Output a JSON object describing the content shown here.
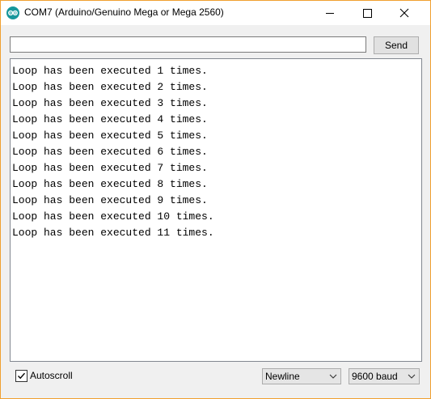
{
  "window": {
    "title": "COM7 (Arduino/Genuino Mega or Mega 2560)",
    "app_icon": "arduino-logo-icon",
    "accent_color": "#f0a030"
  },
  "send": {
    "input_value": "",
    "button_label": "Send"
  },
  "output": {
    "lines": [
      "Loop has been executed 1 times.",
      "Loop has been executed 2 times.",
      "Loop has been executed 3 times.",
      "Loop has been executed 4 times.",
      "Loop has been executed 5 times.",
      "Loop has been executed 6 times.",
      "Loop has been executed 7 times.",
      "Loop has been executed 8 times.",
      "Loop has been executed 9 times.",
      "Loop has been executed 10 times.",
      "Loop has been executed 11 times."
    ]
  },
  "footer": {
    "autoscroll_label": "Autoscroll",
    "autoscroll_checked": true,
    "line_ending_selected": "Newline",
    "baud_selected": "9600 baud"
  }
}
